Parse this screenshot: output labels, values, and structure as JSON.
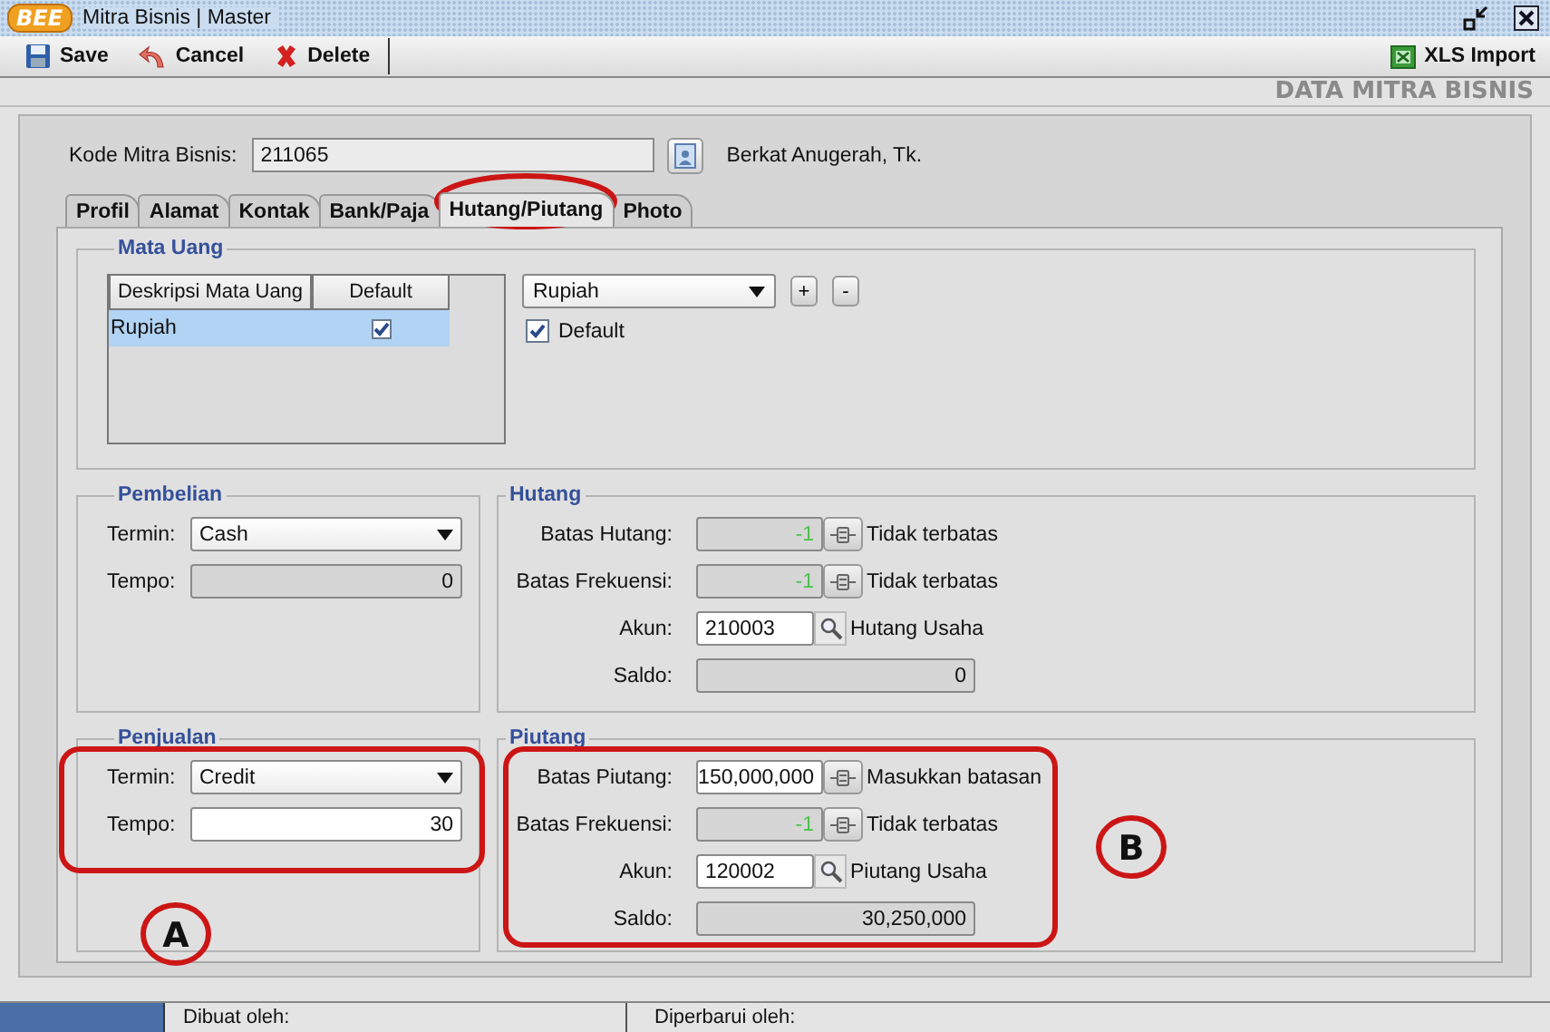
{
  "window": {
    "logo": "BEE",
    "title": "Mitra Bisnis | Master"
  },
  "toolbar": {
    "buttons": [
      {
        "kind": "save",
        "label": "Save"
      },
      {
        "kind": "cancel",
        "label": "Cancel"
      },
      {
        "kind": "delete",
        "label": "Delete"
      }
    ],
    "import_button": "XLS Import"
  },
  "header": "DATA MITRA BISNIS",
  "kode": {
    "label": "Kode Mitra Bisnis:",
    "value": "211065",
    "partner_name": "Berkat Anugerah, Tk."
  },
  "tabs": [
    {
      "label": "Profil",
      "selected": false
    },
    {
      "label": "Alamat",
      "selected": false
    },
    {
      "label": "Kontak",
      "selected": false
    },
    {
      "label": "Bank/Paja",
      "selected": false
    },
    {
      "label": "Hutang/Piutang",
      "selected": true
    },
    {
      "label": "Photo",
      "selected": false
    }
  ],
  "mata_uang": {
    "title": "Mata Uang",
    "columns": [
      "Deskripsi Mata Uang",
      "Default"
    ],
    "rows": [
      {
        "description": "Rupiah",
        "default": true,
        "selected": true
      }
    ],
    "currency": "Rupiah",
    "add": "+",
    "remove": "-",
    "default_label": "Default",
    "default_checked": true
  },
  "pembelian": {
    "title": "Pembelian",
    "fields": [
      {
        "kind": "select",
        "label": "Termin:",
        "value": "Cash",
        "disabled": false
      },
      {
        "kind": "number",
        "label": "Tempo:",
        "value": "0",
        "disabled": true
      }
    ]
  },
  "hutang": {
    "title": "Hutang",
    "fields": [
      {
        "kind": "limit",
        "label": "Batas Hutang:",
        "value": "-1",
        "disabled": true,
        "note": "Tidak terbatas"
      },
      {
        "kind": "limit",
        "label": "Batas Frekuensi:",
        "value": "-1",
        "disabled": true,
        "note": "Tidak terbatas"
      },
      {
        "kind": "account",
        "label": "Akun:",
        "value": "210003",
        "disabled": false,
        "note": "Hutang Usaha"
      },
      {
        "kind": "amount",
        "label": "Saldo:",
        "value": "0",
        "disabled": true
      }
    ]
  },
  "penjualan": {
    "title": "Penjualan",
    "fields": [
      {
        "kind": "select",
        "label": "Termin:",
        "value": "Credit",
        "disabled": false
      },
      {
        "kind": "number",
        "label": "Tempo:",
        "value": "30",
        "disabled": false
      }
    ]
  },
  "piutang": {
    "title": "Piutang",
    "fields": [
      {
        "kind": "limit",
        "label": "Batas Piutang:",
        "value": "150,000,000",
        "disabled": false,
        "note": "Masukkan batasan"
      },
      {
        "kind": "limit",
        "label": "Batas Frekuensi:",
        "value": "-1",
        "disabled": true,
        "note": "Tidak terbatas"
      },
      {
        "kind": "account",
        "label": "Akun:",
        "value": "120002",
        "disabled": false,
        "note": "Piutang Usaha"
      },
      {
        "kind": "amount",
        "label": "Saldo:",
        "value": "30,250,000",
        "disabled": true
      }
    ]
  },
  "status_bar": {
    "created_label": "Dibuat oleh:",
    "updated_label": "Diperbarui oleh:"
  },
  "annotations": [
    "A",
    "B"
  ]
}
